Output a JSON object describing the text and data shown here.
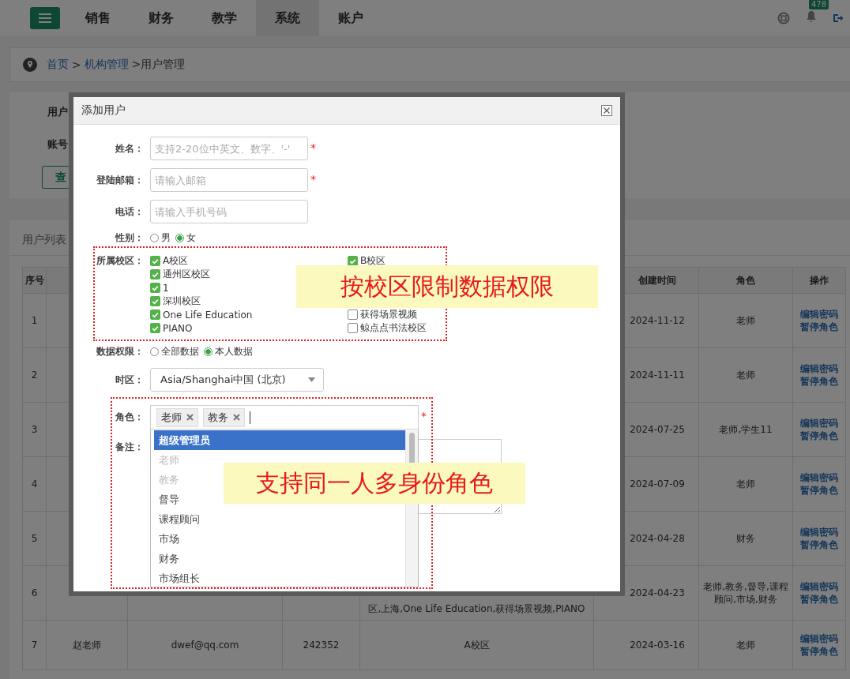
{
  "header": {
    "tabs": [
      {
        "label": "销售",
        "selected": false
      },
      {
        "label": "财务",
        "selected": false
      },
      {
        "label": "教学",
        "selected": false
      },
      {
        "label": "系统",
        "selected": true
      },
      {
        "label": "账户",
        "selected": false
      }
    ],
    "notification_badge": "478"
  },
  "breadcrumb": [
    {
      "label": "首页",
      "link": true
    },
    {
      "label": ">",
      "link": false
    },
    {
      "label": "机构管理",
      "link": true
    },
    {
      "label": ">用户管理",
      "link": false
    }
  ],
  "filters": {
    "labels": [
      "用户",
      "账号"
    ],
    "query_button": "查"
  },
  "user_list": {
    "title": "用户列表",
    "columns": {
      "no": "序号",
      "created": "创建时间",
      "role": "角色",
      "actions": "操作"
    },
    "rows": [
      {
        "no": "1",
        "created": "2024-11-12",
        "role": "老师",
        "actions": [
          "编辑",
          "密码",
          "暂停",
          "角色"
        ]
      },
      {
        "no": "2",
        "created": "2024-11-11",
        "role": "老师",
        "actions": [
          "编辑",
          "密码",
          "暂停",
          "角色"
        ]
      },
      {
        "no": "3",
        "created": "2024-07-25",
        "role": "老师,学生11",
        "actions": [
          "编辑",
          "密码",
          "暂停",
          "角色"
        ]
      },
      {
        "no": "4",
        "created": "2024-07-09",
        "role": "老师",
        "actions": [
          "编辑",
          "密码",
          "暂停",
          "角色"
        ]
      },
      {
        "no": "5",
        "created": "2024-04-28",
        "role": "财务",
        "actions": [
          "编辑",
          "密码",
          "暂停",
          "角色"
        ]
      },
      {
        "no": "6",
        "campus": "区,上海,One Life Education,获得场景视频,PIANO",
        "created": "2024-04-23",
        "role": "老师,教务,督导,课程顾问,市场,财务",
        "actions": [
          "编辑",
          "密码",
          "暂停",
          "角色"
        ]
      },
      {
        "no": "7",
        "name": "赵老师",
        "email": "dwef@qq.com",
        "phone": "242352",
        "campus": "A校区",
        "created": "2024-03-16",
        "role": "老师",
        "actions": [
          "编辑",
          "密码",
          "暂停",
          "角色"
        ]
      }
    ]
  },
  "dialog": {
    "title": "添加用户",
    "fields": [
      {
        "kind": "text",
        "label": "姓名：",
        "placeholder": "支持2-20位中英文、数字、'-'",
        "required_mark": "*"
      },
      {
        "kind": "text",
        "label": "登陆邮箱：",
        "placeholder": "请输入邮箱",
        "required_mark": "*"
      },
      {
        "kind": "text",
        "label": "电话：",
        "placeholder": "请输入手机号码"
      },
      {
        "kind": "radio",
        "label": "性别：",
        "options": [
          {
            "label": "男",
            "selected": false
          },
          {
            "label": "女",
            "selected": true
          }
        ]
      },
      {
        "kind": "checkgroup",
        "label": "所属校区：",
        "left": [
          {
            "label": "A校区",
            "checked": true
          },
          {
            "label": "通州区校区",
            "checked": true
          },
          {
            "label": "1",
            "checked": true
          },
          {
            "label": "深圳校区",
            "checked": true
          },
          {
            "label": "One Life Education",
            "checked": true
          },
          {
            "label": "PIANO",
            "checked": true
          }
        ],
        "right": [
          {
            "label": "B校区",
            "checked": true
          },
          {
            "label": "获得场景视频",
            "checked": false
          },
          {
            "label": "鲸点点书法校区",
            "checked": false
          }
        ]
      },
      {
        "kind": "radio",
        "label": "数据权限：",
        "options": [
          {
            "label": "全部数据",
            "selected": false
          },
          {
            "label": "本人数据",
            "selected": true
          }
        ]
      },
      {
        "kind": "select",
        "label": "时区：",
        "value": "Asia/Shanghai中国 (北京)"
      },
      {
        "kind": "tags",
        "label": "角色：",
        "required_mark": "*",
        "tags": [
          "老师",
          "教务"
        ],
        "options": [
          {
            "label": "超级管理员",
            "selected": true,
            "disabled": false
          },
          {
            "label": "老师",
            "selected": false,
            "disabled": true
          },
          {
            "label": "教务",
            "selected": false,
            "disabled": true
          },
          {
            "label": "督导",
            "selected": false,
            "disabled": false
          },
          {
            "label": "课程顾问",
            "selected": false,
            "disabled": false
          },
          {
            "label": "市场",
            "selected": false,
            "disabled": false
          },
          {
            "label": "财务",
            "selected": false,
            "disabled": false
          },
          {
            "label": "市场组长",
            "selected": false,
            "disabled": false
          }
        ]
      },
      {
        "kind": "textarea",
        "label": "备注："
      }
    ]
  },
  "annotations": [
    {
      "text": "按校区限制数据权限"
    },
    {
      "text": "支持同一人多身份角色"
    }
  ]
}
